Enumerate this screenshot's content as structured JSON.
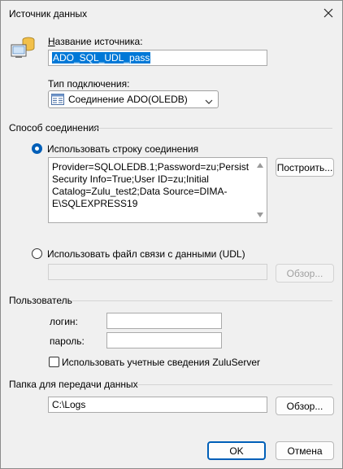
{
  "window": {
    "title": "Источник данных"
  },
  "source": {
    "name_label": "Название источника:",
    "name_value": "ADO_SQL_UDL_pass",
    "type_label": "Тип подключения:",
    "type_value": "Соединение ADO(OLEDB)"
  },
  "connection": {
    "group_title": "Способ соединения",
    "use_string_label": "Использовать строку соединения",
    "use_string_checked": true,
    "connection_string": "Provider=SQLOLEDB.1;Password=zu;Persist Security Info=True;User ID=zu;Initial Catalog=Zulu_test2;Data Source=DIMA-E\\SQLEXPRESS19",
    "build_button": "Построить...",
    "use_udl_label": "Использовать файл связи с данными (UDL)",
    "use_udl_checked": false,
    "udl_value": "",
    "udl_browse_button": "Обзор..."
  },
  "user": {
    "group_title": "Пользователь",
    "login_label": "логин:",
    "login_value": "",
    "password_label": "пароль:",
    "password_value": "",
    "use_zulu_label": "Использовать учетные сведения ZuluServer",
    "use_zulu_checked": false
  },
  "folder": {
    "group_title": "Папка для передачи данных",
    "path_value": "C:\\Logs",
    "browse_button": "Обзор..."
  },
  "footer": {
    "ok_button": "OK",
    "cancel_button": "Отмена"
  },
  "colors": {
    "accent": "#005fb8",
    "selection": "#0078d7",
    "background": "#f0f0f0"
  }
}
